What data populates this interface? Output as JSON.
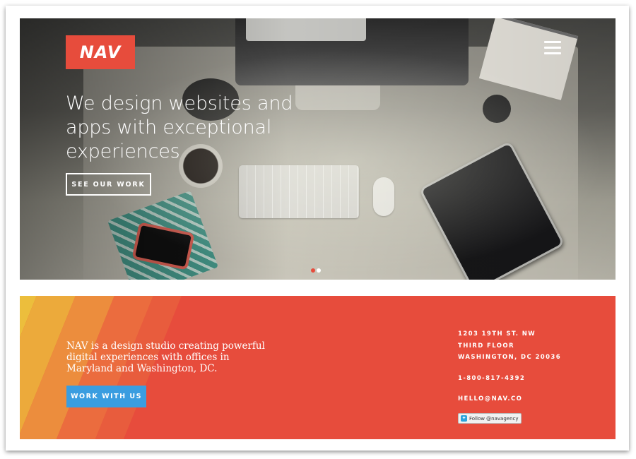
{
  "hero": {
    "logo_text": "NAV",
    "headline": "We design websites and apps with exceptional experiences",
    "cta_label": "SEE OUR WORK",
    "slides": {
      "count": 2,
      "active_index": 0
    }
  },
  "icons": {
    "menu": "hamburger-menu-icon",
    "twitter": "twitter-bird-icon"
  },
  "about": {
    "text": "NAV is a design studio creating powerful digital experiences with offices in Maryland and Washington, DC.",
    "button_label": "WORK WITH US"
  },
  "contact": {
    "address_line1": "1203 19TH ST. NW",
    "address_line2": "THIRD FLOOR",
    "address_line3": "WASHINGTON, DC 20036",
    "phone": "1-800-817-4392",
    "email": "HELLO@NAV.CO",
    "twitter_follow": "Follow @navagency"
  },
  "colors": {
    "brand_red": "#e74c3c",
    "button_blue": "#3a9de0",
    "stripe_yellow": "#ecbe3c",
    "stripe_orange": "#ec8d3d"
  }
}
